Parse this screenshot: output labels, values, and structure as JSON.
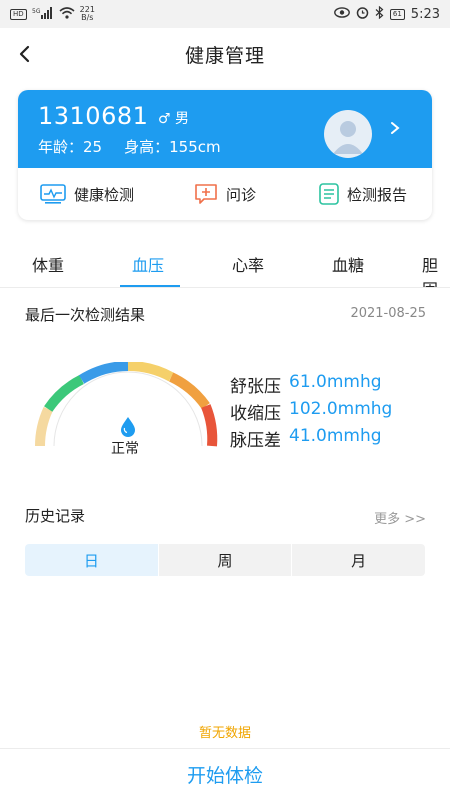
{
  "status_bar": {
    "network": "5G",
    "speed_value": "221",
    "speed_unit": "B/s",
    "battery": "61",
    "time": "5:23",
    "icons": [
      "hd-icon",
      "signal-icon",
      "wifi-icon",
      "eye-icon",
      "alarm-icon",
      "bluetooth-icon",
      "battery-icon"
    ]
  },
  "header": {
    "title": "健康管理"
  },
  "profile": {
    "id": "1310681",
    "gender_symbol": "♂",
    "gender": "男",
    "age_label": "年龄：",
    "age": "25",
    "height_label": "身高：",
    "height": "155cm"
  },
  "quick_actions": [
    {
      "label": "健康检测",
      "icon": "monitor-icon",
      "color": "#1e9cf0"
    },
    {
      "label": "问诊",
      "icon": "chat-plus-icon",
      "color": "#f0704a"
    },
    {
      "label": "检测报告",
      "icon": "report-icon",
      "color": "#2bc3a0"
    }
  ],
  "tabs": [
    {
      "label": "体重",
      "active": false
    },
    {
      "label": "血压",
      "active": true
    },
    {
      "label": "心率",
      "active": false
    },
    {
      "label": "血糖",
      "active": false
    },
    {
      "label": "胆固",
      "active": false
    }
  ],
  "result": {
    "title": "最后一次检测结果",
    "date": "2021-08-25",
    "status": "正常",
    "rows": [
      {
        "label": "舒张压",
        "value": "61.0mmhg"
      },
      {
        "label": "收缩压",
        "value": "102.0mmhg"
      },
      {
        "label": "脉压差",
        "value": "41.0mmhg"
      }
    ]
  },
  "history": {
    "title": "历史记录",
    "more": "更多 >>",
    "segments": [
      {
        "label": "日",
        "active": true
      },
      {
        "label": "周",
        "active": false
      },
      {
        "label": "月",
        "active": false
      }
    ],
    "empty": "暂无数据"
  },
  "start_button": "开始体检",
  "colors": {
    "primary": "#1e9cf0",
    "warning": "#f0a500",
    "gauge": [
      "#f5d9a0",
      "#3cc87a",
      "#3a9be8",
      "#f5d06a",
      "#f0a040",
      "#e8553a"
    ]
  }
}
